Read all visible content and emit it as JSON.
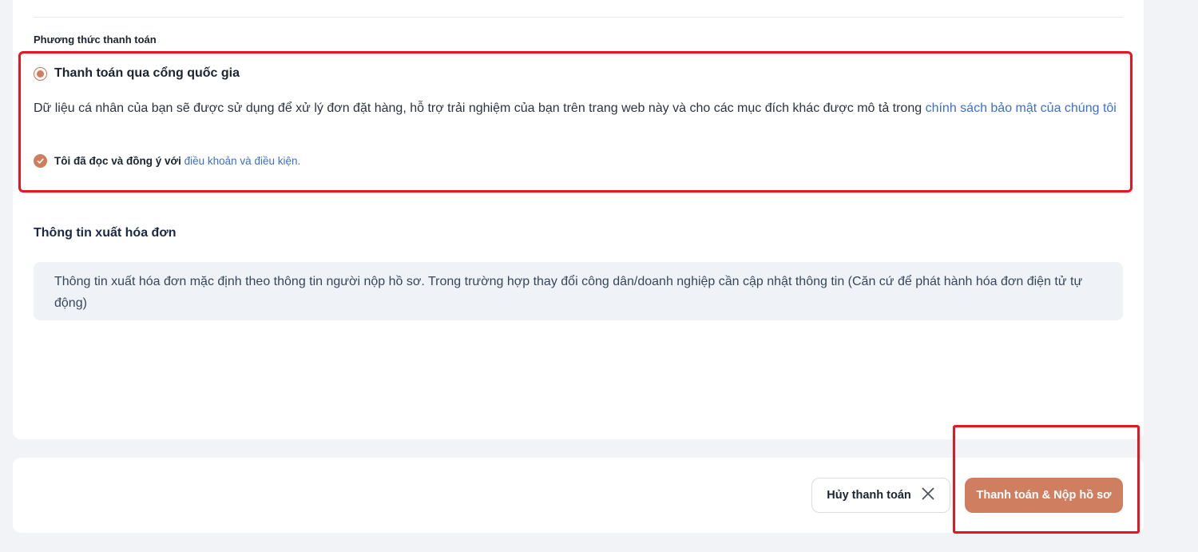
{
  "payment": {
    "section_label": "Phương thức thanh toán",
    "option_label": "Thanh toán qua cổng quốc gia",
    "option_selected": true,
    "privacy_text": "Dữ liệu cá nhân của bạn sẽ được sử dụng để xử lý đơn đặt hàng, hỗ trợ trải nghiệm của bạn trên trang web này và cho các mục đích khác được mô tả trong ",
    "privacy_link": "chính sách bảo mật của chúng tôi",
    "agree_text": "Tôi đã đọc và đồng ý với ",
    "agree_link": "điều khoản và điều kiện.",
    "agree_checked": true
  },
  "invoice": {
    "title": "Thông tin xuất hóa đơn",
    "info": "Thông tin xuất hóa đơn mặc định theo thông tin người nộp hồ sơ. Trong trường hợp thay đổi công dân/doanh nghiệp cần cập nhật thông tin (Căn cứ để phát hành hóa đơn điện tử tự động)"
  },
  "actions": {
    "cancel_label": "Hủy thanh toán",
    "cancel_icon": "close-icon",
    "pay_label": "Thanh toán & Nộp hồ sơ"
  },
  "colors": {
    "accent": "#d07e60",
    "link": "#3b6fd1",
    "highlight": "#e8141f"
  }
}
